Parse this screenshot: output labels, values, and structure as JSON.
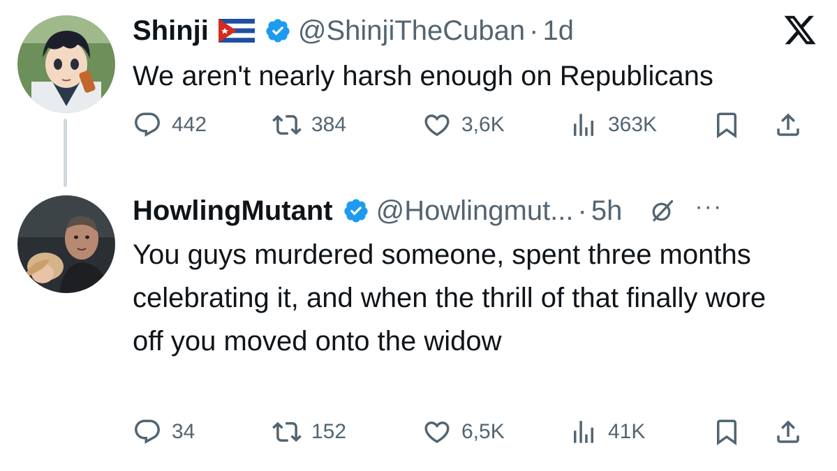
{
  "tweets": [
    {
      "name": "Shinji",
      "handle": "@ShinjiTheCuban",
      "time": "1d",
      "text": "We aren't nearly harsh enough on Republicans",
      "stats": {
        "replies": "442",
        "retweets": "384",
        "likes": "3,6K",
        "views": "363K"
      }
    },
    {
      "name": "HowlingMutant",
      "handle": "@Howlingmut...",
      "time": "5h",
      "text": "You guys murdered someone, spent three months celebrating it, and when the thrill of that finally wore off you moved onto the widow",
      "stats": {
        "replies": "34",
        "retweets": "152",
        "likes": "6,5K",
        "views": "41K"
      }
    }
  ],
  "separator": "·",
  "more": "···",
  "icons": {
    "brand": "x-logo-icon",
    "verified": "verified-badge-icon",
    "flag": "cuba-flag-icon",
    "grok": "grok-icon",
    "reply": "reply-icon",
    "retweet": "retweet-icon",
    "like": "heart-icon",
    "views": "views-icon",
    "bookmark": "bookmark-icon",
    "share": "share-icon"
  },
  "colors": {
    "text": "#0f1419",
    "muted": "#536471",
    "verified": "#1d9bf0",
    "thread_line": "#cfd9de"
  }
}
